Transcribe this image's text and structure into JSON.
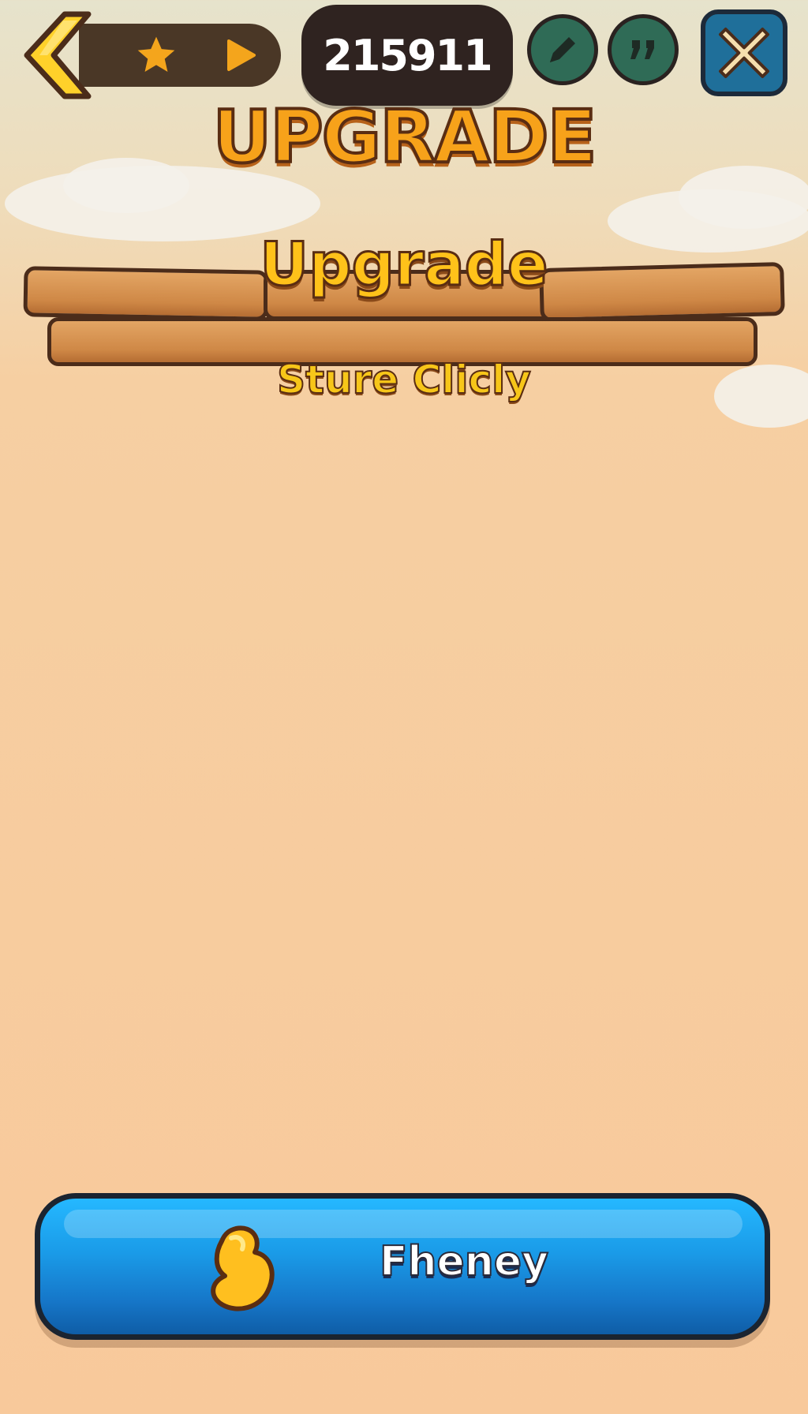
{
  "hud": {
    "score": "215911"
  },
  "header": {
    "title": "UPGRADE"
  },
  "sign": {
    "title": "Upgrade",
    "subtitle": "Sture Clicly"
  },
  "action_button": {
    "label": "Fheney"
  },
  "icons": {
    "back": "chevron-left-icon",
    "star": "star-icon",
    "play": "play-icon",
    "edit": "pencil-icon",
    "quote": "quote-icon",
    "close": "close-icon",
    "coin": "gold-coin-icon"
  },
  "colors": {
    "title_orange": "#f7a21a",
    "button_blue": "#1a9be8",
    "round_button_green": "#2f6b56",
    "close_button_blue": "#1f6f9a"
  }
}
